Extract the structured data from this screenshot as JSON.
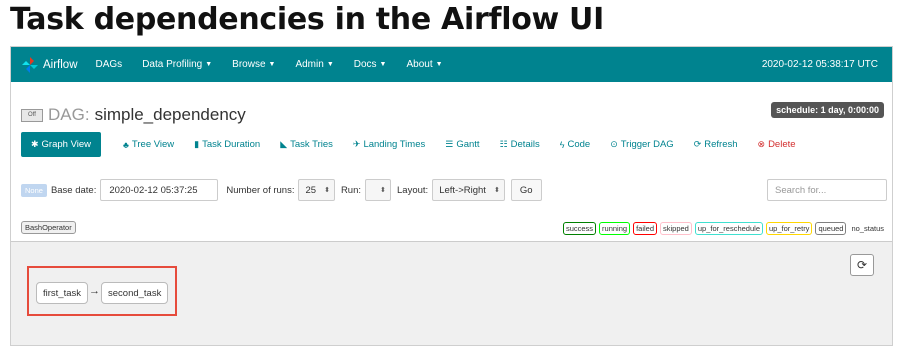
{
  "slide_title": "Task dependencies in the Airflow UI",
  "navbar": {
    "brand": "Airflow",
    "items": [
      {
        "label": "DAGs",
        "dropdown": false
      },
      {
        "label": "Data Profiling",
        "dropdown": true
      },
      {
        "label": "Browse",
        "dropdown": true
      },
      {
        "label": "Admin",
        "dropdown": true
      },
      {
        "label": "Docs",
        "dropdown": true
      },
      {
        "label": "About",
        "dropdown": true
      }
    ],
    "clock": "2020-02-12 05:38:17 UTC"
  },
  "dag": {
    "toggle": "Off",
    "label": "DAG:",
    "id": "simple_dependency",
    "schedule": "schedule: 1 day, 0:00:00"
  },
  "tabs": [
    {
      "label": "Graph View",
      "icon": "asterisk-icon"
    },
    {
      "label": "Tree View",
      "icon": "tree-icon"
    },
    {
      "label": "Task Duration",
      "icon": "bar-chart-icon"
    },
    {
      "label": "Task Tries",
      "icon": "plane-icon"
    },
    {
      "label": "Landing Times",
      "icon": "landing-icon"
    },
    {
      "label": "Gantt",
      "icon": "gantt-icon"
    },
    {
      "label": "Details",
      "icon": "list-icon"
    },
    {
      "label": "Code",
      "icon": "flash-icon"
    },
    {
      "label": "Trigger DAG",
      "icon": "play-circle-icon"
    },
    {
      "label": "Refresh",
      "icon": "refresh-icon"
    },
    {
      "label": "Delete",
      "icon": "delete-icon"
    }
  ],
  "controls": {
    "none_badge": "None",
    "base_date_label": "Base date:",
    "base_date_value": "2020-02-12 05:37:25",
    "runs_label": "Number of runs:",
    "runs_value": "25",
    "run_label": "Run:",
    "run_value": "",
    "layout_label": "Layout:",
    "layout_value": "Left->Right",
    "go_label": "Go",
    "search_placeholder": "Search for..."
  },
  "legend": {
    "operator": "BashOperator",
    "states": [
      {
        "label": "success",
        "color": "#008000"
      },
      {
        "label": "running",
        "color": "#00ff00"
      },
      {
        "label": "failed",
        "color": "#ff0000"
      },
      {
        "label": "skipped",
        "color": "#ffc0cb"
      },
      {
        "label": "up_for_reschedule",
        "color": "#40e0d0"
      },
      {
        "label": "up_for_retry",
        "color": "#ffd700"
      },
      {
        "label": "queued",
        "color": "#808080"
      },
      {
        "label": "no_status",
        "color": ""
      }
    ]
  },
  "graph": {
    "tasks": [
      "first_task",
      "second_task"
    ],
    "edge": "→",
    "highlight_color": "#e64b3c"
  }
}
